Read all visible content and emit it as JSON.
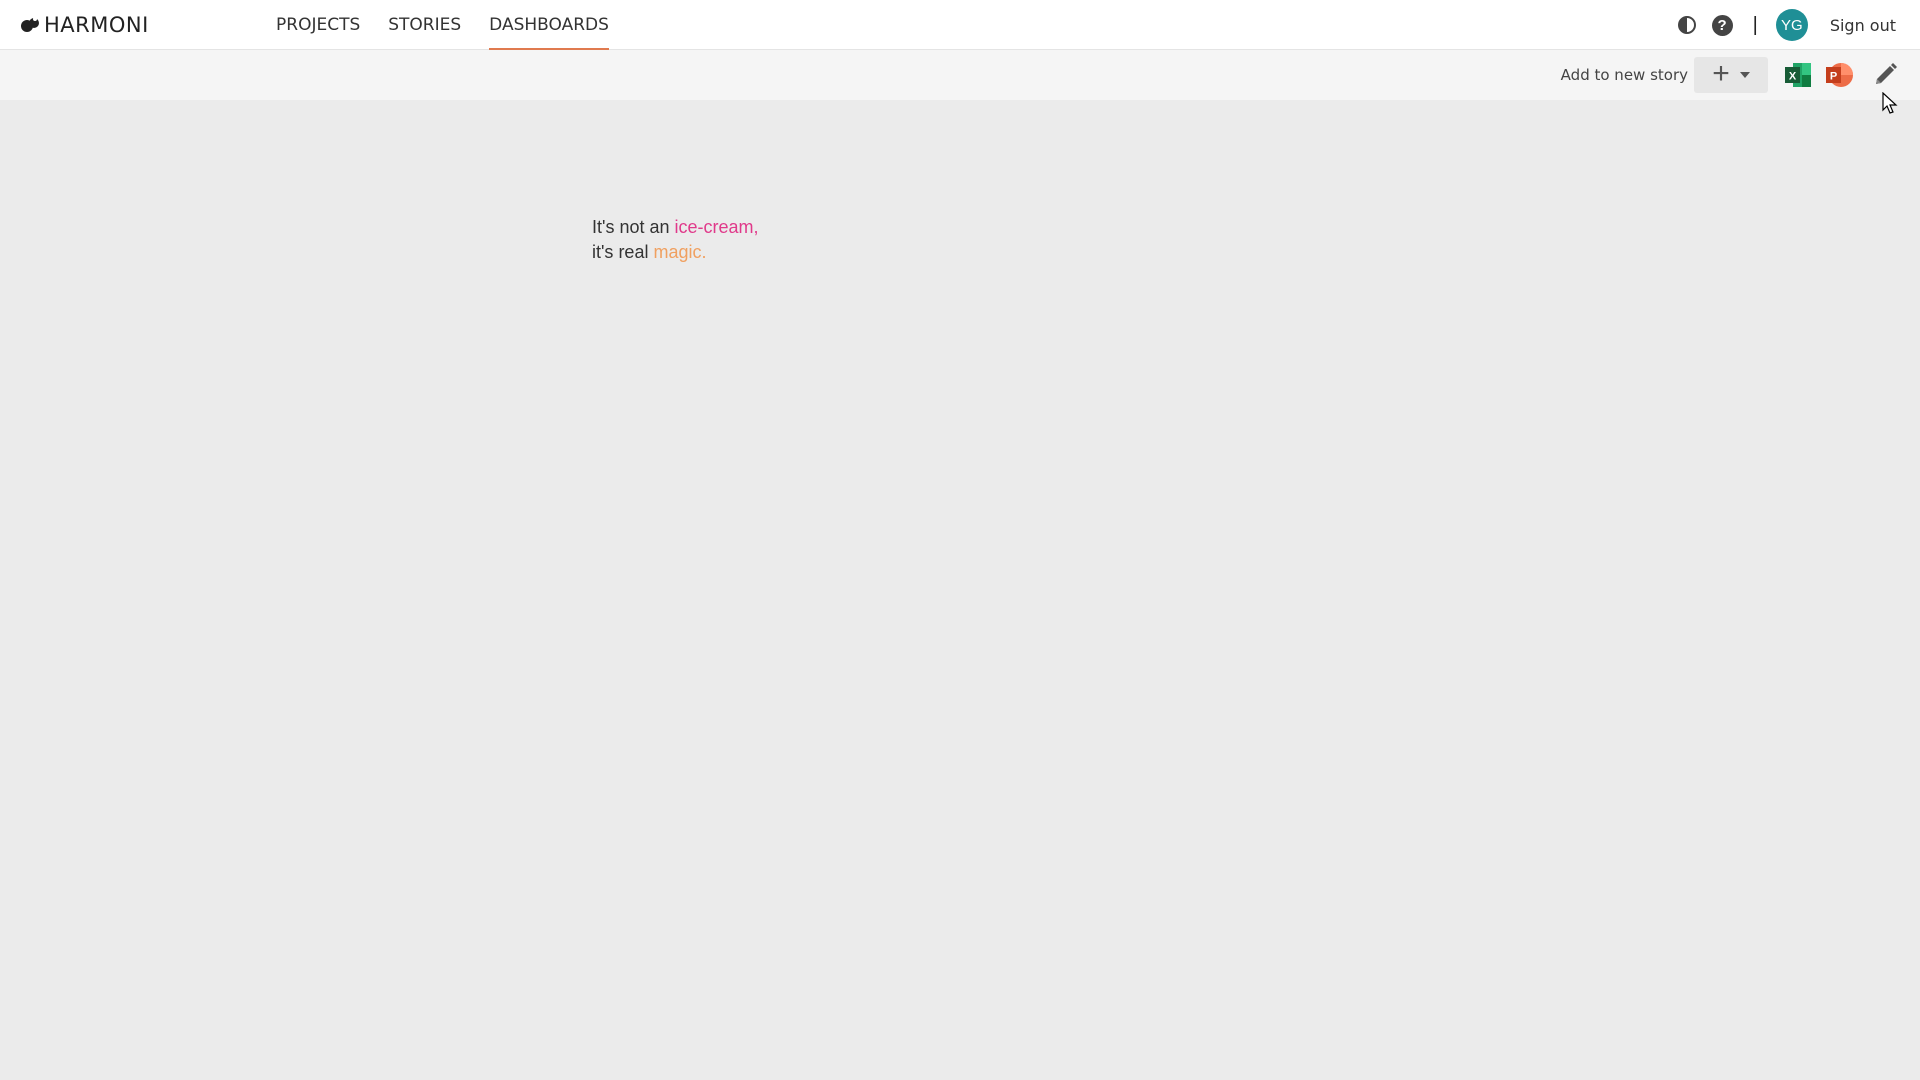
{
  "app": {
    "brand": "HARMONI"
  },
  "nav": {
    "items": [
      {
        "label": "PROJECTS",
        "active": false
      },
      {
        "label": "STORIES",
        "active": false
      },
      {
        "label": "DASHBOARDS",
        "active": true
      }
    ],
    "active_color": "#e07a4f"
  },
  "header": {
    "separator": "|",
    "avatar_initials": "YG",
    "avatar_color": "#1f8f96",
    "signout_label": "Sign out",
    "help_glyph": "?",
    "icons": [
      "contrast-icon",
      "help-icon"
    ]
  },
  "toolbar": {
    "add_to_story_label": "Add to new story",
    "add_glyph": "+",
    "excel_letter": "X",
    "ppt_letter": "P",
    "icons": [
      "plus-icon",
      "caret-down-icon",
      "excel-icon",
      "powerpoint-icon",
      "pencil-icon"
    ]
  },
  "main": {
    "line1_prefix": "It's not an",
    "line1_highlight": "ice-cream,",
    "line2_prefix": "it's real",
    "line2_highlight": "magic.",
    "highlight_colors": {
      "pink": "#e0398a",
      "orange": "#f0a060"
    }
  }
}
